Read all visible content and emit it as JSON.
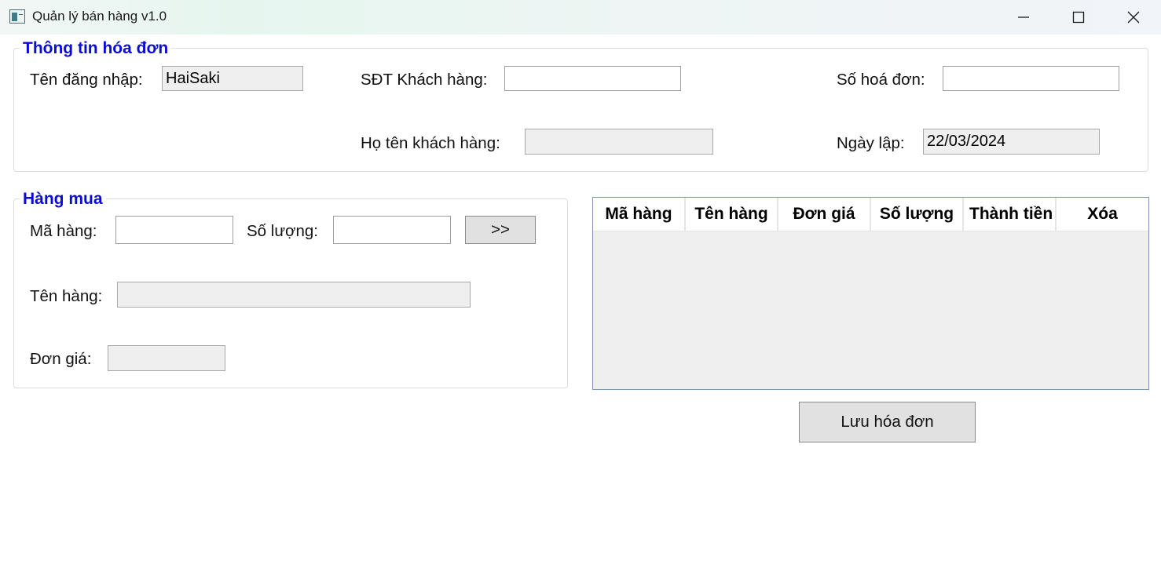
{
  "window": {
    "title": "Quản lý bán hàng v1.0",
    "icons": [
      "app-icon",
      "minimize-icon",
      "maximize-icon",
      "close-icon"
    ]
  },
  "invoice_info": {
    "group_title": "Thông tin hóa đơn",
    "username_label": "Tên đăng nhập:",
    "username_value": "HaiSaki",
    "phone_label": "SĐT Khách hàng:",
    "phone_value": "",
    "invoice_no_label": "Số hoá đơn:",
    "invoice_no_value": "",
    "customer_name_label": "Họ tên khách hàng:",
    "customer_name_value": "",
    "date_label": "Ngày lập:",
    "date_value": "22/03/2024"
  },
  "purchase": {
    "group_title": "Hàng mua",
    "item_code_label": "Mã hàng:",
    "item_code_value": "",
    "quantity_label": "Số lượng:",
    "quantity_value": "",
    "add_button": ">>",
    "item_name_label": "Tên hàng:",
    "item_name_value": "",
    "unit_price_label": "Đơn giá:",
    "unit_price_value": ""
  },
  "grid": {
    "columns": [
      "Mã hàng",
      "Tên hàng",
      "Đơn giá",
      "Số lượng",
      "Thành tiền",
      "Xóa"
    ],
    "rows": []
  },
  "actions": {
    "save_button": "Lưu hóa đơn"
  }
}
